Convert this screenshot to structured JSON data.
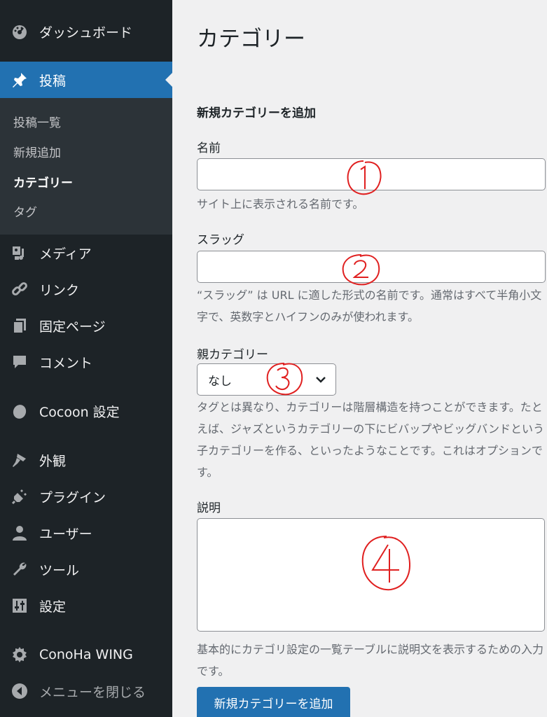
{
  "sidebar": {
    "dashboard": "ダッシュボード",
    "posts": "投稿",
    "submenu": {
      "all_posts": "投稿一覧",
      "add_new": "新規追加",
      "categories": "カテゴリー",
      "tags": "タグ"
    },
    "media": "メディア",
    "links": "リンク",
    "pages": "固定ページ",
    "comments": "コメント",
    "cocoon": "Cocoon 設定",
    "appearance": "外観",
    "plugins": "プラグイン",
    "users": "ユーザー",
    "tools": "ツール",
    "settings": "設定",
    "conoha": "ConoHa WING",
    "collapse": "メニューを閉じる"
  },
  "main": {
    "page_title": "カテゴリー",
    "section_title": "新規カテゴリーを追加",
    "name": {
      "label": "名前",
      "value": "",
      "help": "サイト上に表示される名前です。"
    },
    "slug": {
      "label": "スラッグ",
      "value": "",
      "help": "“スラッグ” は URL に適した形式の名前です。通常はすべて半角小文字で、英数字とハイフンのみが使われます。"
    },
    "parent": {
      "label": "親カテゴリー",
      "selected": "なし",
      "help": "タグとは異なり、カテゴリーは階層構造を持つことができます。たとえば、ジャズというカテゴリーの下にビバップやビッグバンドという子カテゴリーを作る、といったようなことです。これはオプションです。"
    },
    "description": {
      "label": "説明",
      "value": "",
      "help": "基本的にカテゴリ設定の一覧テーブルに説明文を表示するための入力です。"
    },
    "submit_label": "新規カテゴリーを追加"
  },
  "colors": {
    "sidebar_bg": "#1d2327",
    "submenu_bg": "#2c3338",
    "accent": "#2271b1",
    "annotation": "#e02020"
  },
  "annotations": [
    "①",
    "②",
    "③",
    "④"
  ]
}
